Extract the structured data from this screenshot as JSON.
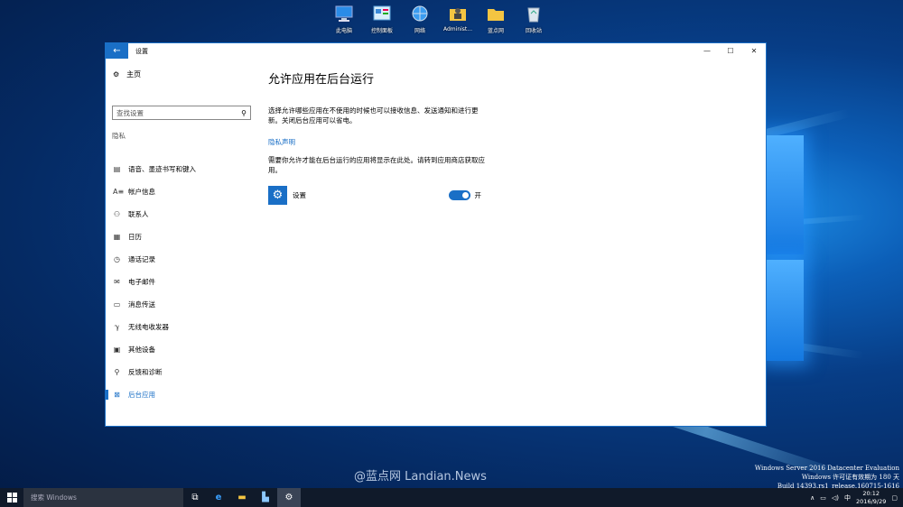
{
  "desktop": {
    "icons": [
      {
        "label": "此电脑",
        "icon": "computer-icon"
      },
      {
        "label": "控制面板",
        "icon": "control-panel-icon"
      },
      {
        "label": "网络",
        "icon": "network-icon"
      },
      {
        "label": "Administ...",
        "icon": "user-folder-icon"
      },
      {
        "label": "蓝点网",
        "icon": "folder-icon"
      },
      {
        "label": "回收站",
        "icon": "recycle-bin-icon"
      }
    ],
    "watermark": "@蓝点网 Landian.News",
    "build_info": [
      "Windows Server 2016 Datacenter Evaluation",
      "Windows 许可证有效期为 180 天",
      "Build 14393.rs1_release.160715-1616"
    ]
  },
  "window": {
    "title": "设置",
    "back_icon": "←",
    "controls": {
      "minimize": "—",
      "maximize": "☐",
      "close": "✕"
    }
  },
  "sidebar": {
    "home_label": "主页",
    "search_placeholder": "查找设置",
    "section": "隐私",
    "items": [
      {
        "label": "语音、墨迹书写和键入",
        "icon": "▤"
      },
      {
        "label": "帐户信息",
        "icon": "A≡"
      },
      {
        "label": "联系人",
        "icon": "⚇"
      },
      {
        "label": "日历",
        "icon": "▦"
      },
      {
        "label": "通话记录",
        "icon": "◷"
      },
      {
        "label": "电子邮件",
        "icon": "✉"
      },
      {
        "label": "消息传送",
        "icon": "▭"
      },
      {
        "label": "无线电收发器",
        "icon": "ℽ"
      },
      {
        "label": "其他设备",
        "icon": "▣"
      },
      {
        "label": "反馈和诊断",
        "icon": "⚲"
      },
      {
        "label": "后台应用",
        "icon": "⊠"
      }
    ],
    "active_index": 10
  },
  "main": {
    "title": "允许应用在后台运行",
    "description": "选择允许哪些应用在不使用的时候也可以接收信息、发送通知和进行更新。关闭后台应用可以省电。",
    "privacy_link": "隐私声明",
    "description2": "需要你允许才能在后台运行的应用将显示在此处。请转到应用商店获取应用。",
    "apps": [
      {
        "name": "设置",
        "toggle_on": true,
        "toggle_label": "开"
      }
    ]
  },
  "taskbar": {
    "search_placeholder": "搜索 Windows",
    "time": "20:12",
    "date": "2016/9/29",
    "ime": "中"
  }
}
